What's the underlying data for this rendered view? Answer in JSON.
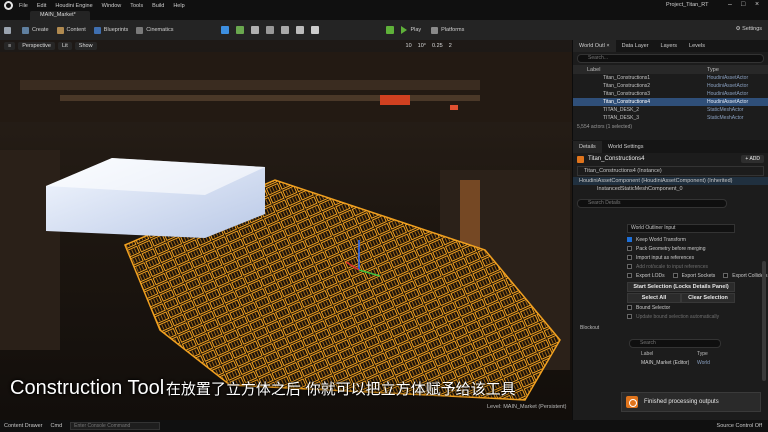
{
  "app": {
    "menu": [
      "File",
      "Edit",
      "Houdini Engine",
      "Window",
      "Tools",
      "Build",
      "Help"
    ],
    "project_name": "Project_Titan_RT",
    "level_tab": "MAIN_Market*"
  },
  "toolbar": {
    "save_icon": "save-icon",
    "create_label": "Create",
    "content_label": "Content",
    "blueprints_label": "Blueprints",
    "cinematics_label": "Cinematics",
    "play_label": "Play",
    "platforms_label": "Platforms",
    "settings_label": "Settings"
  },
  "viewport": {
    "perspective_label": "Perspective",
    "lit_label": "Lit",
    "show_label": "Show",
    "grid_snap": "10",
    "rotation_snap": "10°",
    "scale_snap": "0.25",
    "camera_speed": "2",
    "level_label": "Level: MAIN_Market (Persistent)",
    "subtitle_en": "Construction Tool",
    "subtitle_cn": "在放置了立方体之后 你就可以把立方体赋予给该工具"
  },
  "outliner": {
    "tabs": [
      "World Outl ×",
      "Data Layer",
      "Layers",
      "Levels"
    ],
    "search_placeholder": "Search...",
    "col_label": "Label",
    "col_type": "Type",
    "rows": [
      {
        "label": "Titan_Constructions1",
        "type": "HoudiniAssetActor",
        "selected": false
      },
      {
        "label": "Titan_Constructions2",
        "type": "HoudiniAssetActor",
        "selected": false
      },
      {
        "label": "Titan_Constructions3",
        "type": "HoudiniAssetActor",
        "selected": false
      },
      {
        "label": "Titan_Constructions4",
        "type": "HoudiniAssetActor",
        "selected": true
      },
      {
        "label": "TITAN_DESK_2",
        "type": "StaticMeshActor",
        "selected": false
      },
      {
        "label": "TITAN_DESK_3",
        "type": "StaticMeshActor",
        "selected": false
      }
    ],
    "footer": "5,554 actors (1 selected)"
  },
  "details": {
    "tabs": [
      "Details",
      "World Settings"
    ],
    "actor_name": "Titan_Constructions4",
    "add_label": "+ ADD",
    "instance_label": "Titan_Constructions4 (Instance)",
    "component_root": "HoudiniAssetComponent (HoudiniAssetComponent) (Inherited)",
    "component_child": "InstancedStaticMeshComponent_0",
    "search_placeholder": "Search Details",
    "input_type": "World Outliner Input",
    "options": [
      {
        "label": "Keep World Transform",
        "checked": true,
        "dim": false
      },
      {
        "label": "Pack Geometry before merging",
        "checked": false,
        "dim": false
      },
      {
        "label": "Import input as references",
        "checked": false,
        "dim": false
      },
      {
        "label": "Add rot/scale to input references",
        "checked": false,
        "dim": true
      }
    ],
    "export_options": [
      "Export LODs",
      "Export Sockets",
      "Export Colliders"
    ],
    "start_selection_label": "Start Selection (Locks Details Panel)",
    "select_all_label": "Select All",
    "clear_selection_label": "Clear Selection",
    "bound_selector_label": "Bound Selector",
    "update_label": "Update bound selection automatically",
    "section_label": "Blockout",
    "nested_search": "Search",
    "nested_col_label": "Label",
    "nested_col_type": "Type",
    "nested_row_label": "MAIN_Market (Editor)",
    "nested_row_type": "World"
  },
  "toast": {
    "text": "Finished processing outputs"
  },
  "statusbar": {
    "content_drawer": "Content Drawer",
    "cmd": "Cmd",
    "console_placeholder": "Enter Console Command",
    "source_control": "Source Control Off"
  },
  "colors": {
    "accent": "#1d6fd8",
    "selection": "#2f4f79",
    "wireframe": "#f0a020",
    "houdini": "#e0741c"
  }
}
